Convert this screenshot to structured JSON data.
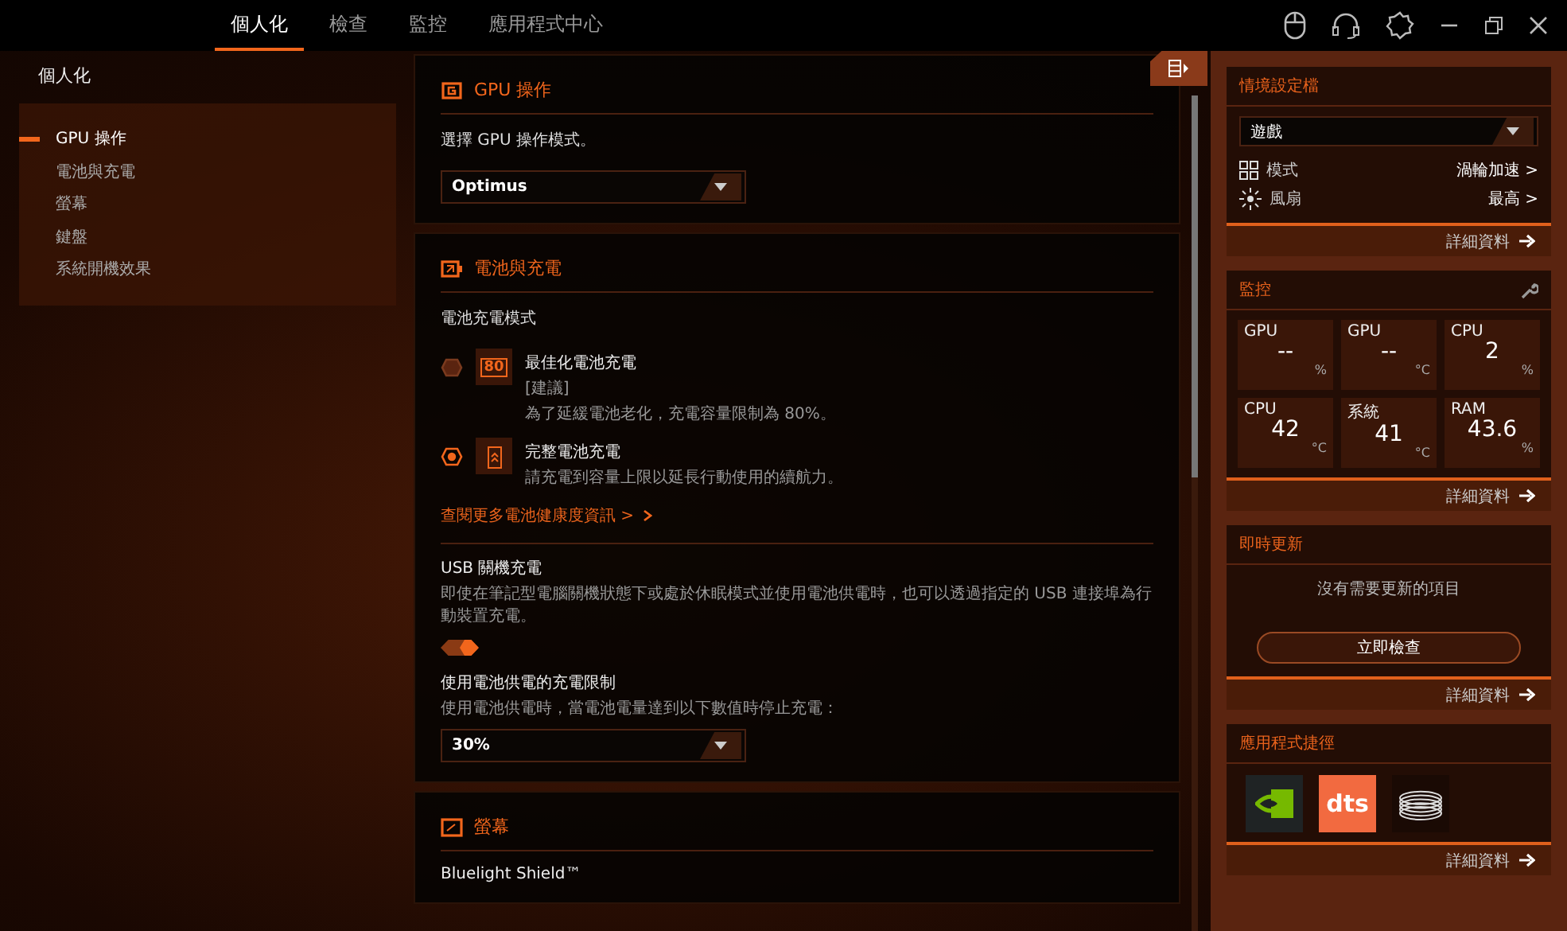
{
  "tabs": [
    {
      "label": "個人化",
      "selected": true
    },
    {
      "label": "檢查",
      "selected": false
    },
    {
      "label": "監控",
      "selected": false
    },
    {
      "label": "應用程式中心",
      "selected": false
    }
  ],
  "page_title": "個人化",
  "sidebar": {
    "items": [
      {
        "label": "GPU 操作",
        "selected": true
      },
      {
        "label": "電池與充電",
        "selected": false
      },
      {
        "label": "螢幕",
        "selected": false
      },
      {
        "label": "鍵盤",
        "selected": false
      },
      {
        "label": "系統開機效果",
        "selected": false
      }
    ]
  },
  "gpu_section": {
    "title": "GPU 操作",
    "prompt": "選擇 GPU 操作模式。",
    "dropdown": {
      "value": "Optimus"
    }
  },
  "battery_section": {
    "title": "電池與充電",
    "mode_label": "電池充電模式",
    "options": [
      {
        "kind": "optimized",
        "title": "最佳化電池充電",
        "note": "[建議]",
        "description": "為了延緩電池老化，充電容量限制為 80%。",
        "badge": "80",
        "selected": false
      },
      {
        "kind": "full",
        "title": "完整電池充電",
        "description": "請充電到容量上限以延長行動使用的續航力。",
        "selected": true
      }
    ],
    "link": "查閱更多電池健康度資訊 >",
    "usb": {
      "title": "USB 關機充電",
      "description": "即使在筆記型電腦關機狀態下或處於休眠模式並使用電池供電時，也可以透過指定的 USB 連接埠為行動裝置充電。",
      "on": true
    },
    "limit": {
      "title": "使用電池供電的充電限制",
      "description": "使用電池供電時，當電池電量達到以下數值時停止充電：",
      "dropdown": {
        "value": "30%"
      }
    }
  },
  "display_section": {
    "title": "螢幕",
    "item": "Bluelight Shield™"
  },
  "profile_card": {
    "title": "情境設定檔",
    "dropdown": {
      "value": "遊戲"
    },
    "rows": [
      {
        "kind": "mode",
        "label": "模式",
        "value": "渦輪加速 >"
      },
      {
        "kind": "fan",
        "label": "風扇",
        "value": "最高 >"
      }
    ],
    "footer": "詳細資料"
  },
  "monitor_card": {
    "title": "監控",
    "tiles": [
      {
        "label": "GPU",
        "value": "--",
        "unit": "%"
      },
      {
        "label": "GPU",
        "value": "--",
        "unit": "°C"
      },
      {
        "label": "CPU",
        "value": "2",
        "unit": "%"
      },
      {
        "label": "CPU",
        "value": "42",
        "unit": "°C"
      },
      {
        "label": "系統",
        "value": "41",
        "unit": "°C"
      },
      {
        "label": "RAM",
        "value": "43.6",
        "unit": "%"
      }
    ],
    "footer": "詳細資料"
  },
  "update_card": {
    "title": "即時更新",
    "message": "沒有需要更新的項目",
    "button": "立即檢查",
    "footer": "詳細資料"
  },
  "apps_card": {
    "title": "應用程式捷徑",
    "apps": [
      {
        "kind": "nvidia"
      },
      {
        "kind": "dts",
        "label": "dts"
      },
      {
        "kind": "coil"
      }
    ],
    "footer": "詳細資料"
  }
}
